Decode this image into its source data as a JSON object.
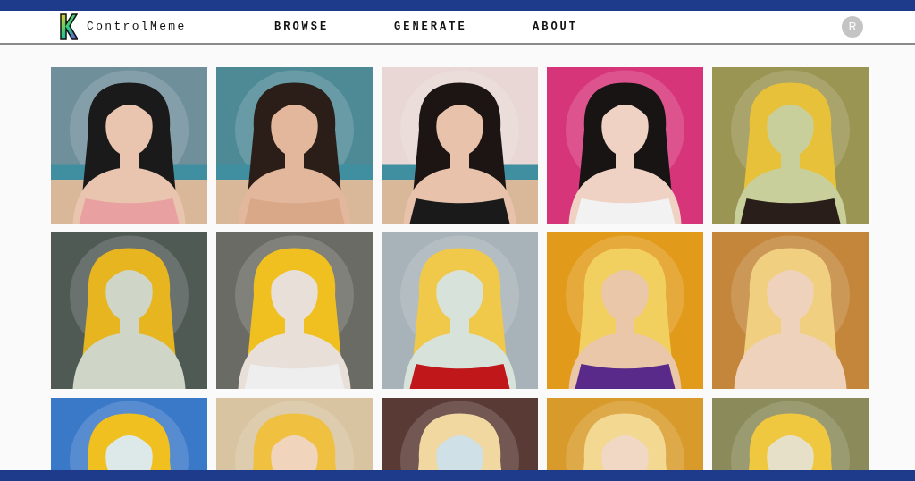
{
  "header": {
    "brand": "ControlMeme",
    "nav": [
      {
        "label": "BROWSE"
      },
      {
        "label": "GENERATE"
      },
      {
        "label": "ABOUT"
      }
    ],
    "avatar": "R"
  }
}
